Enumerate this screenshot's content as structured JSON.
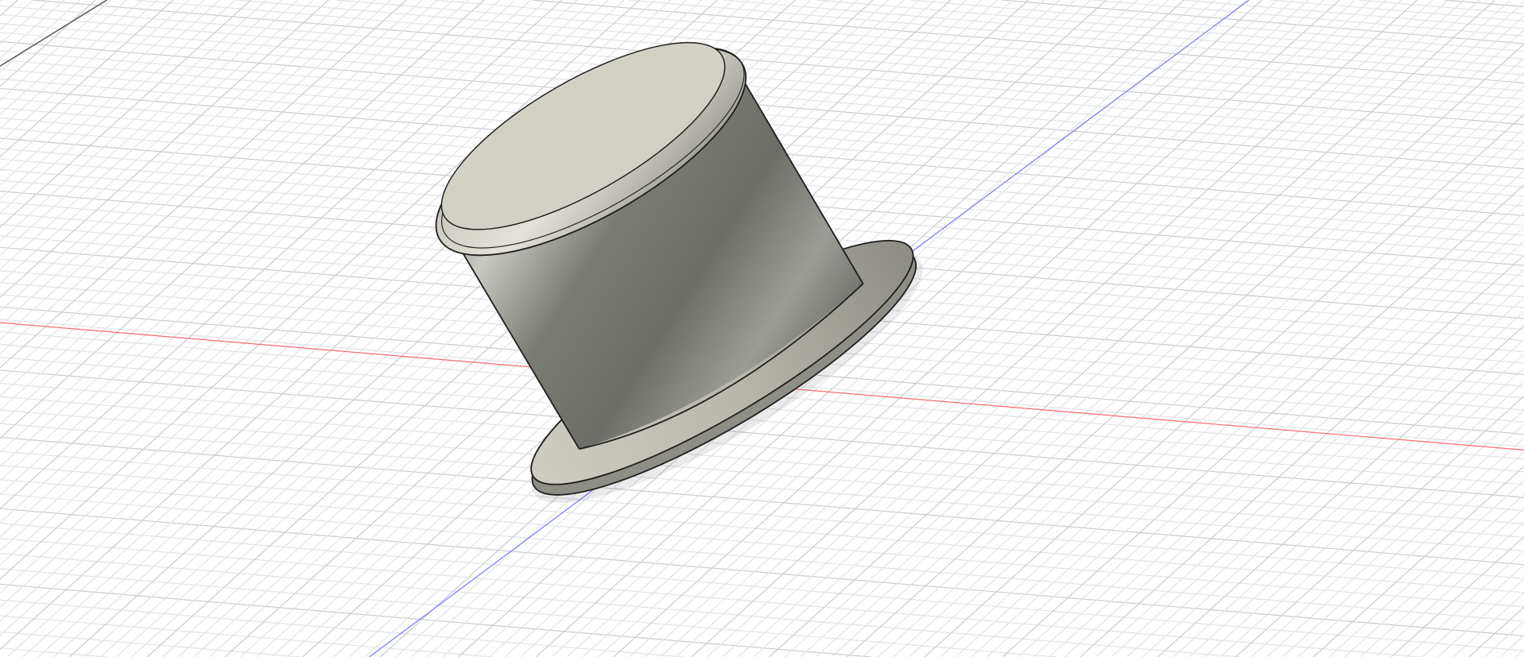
{
  "viewport": {
    "background": "#ffffff",
    "grid_minor_color": "#e2e4e8",
    "grid_major_color": "#c9ccd2",
    "x_axis_color": "#ff6b6b",
    "y_axis_color": "#7a7aff",
    "model_edge_color": "#1e1e1e"
  },
  "model": {
    "name": "cylinder-with-flange",
    "body_color": "#8b8b83",
    "top_face_color": "#d3d1c6"
  }
}
